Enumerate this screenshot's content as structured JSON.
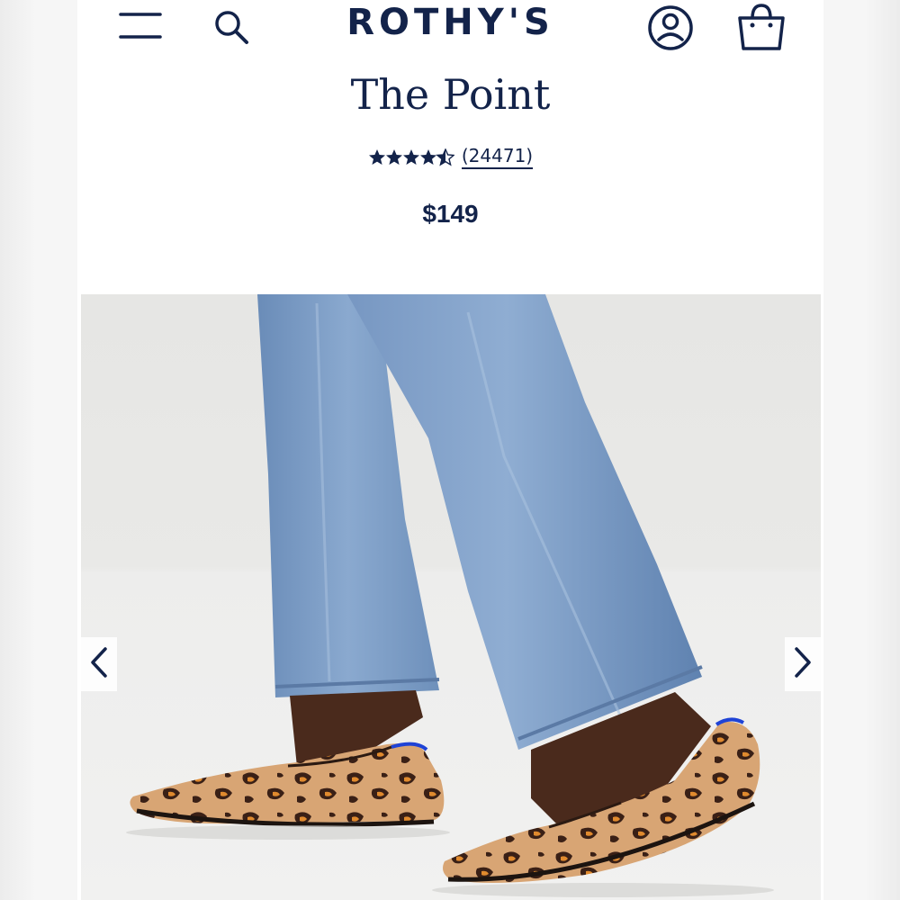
{
  "header": {
    "brand": "ROTHY'S",
    "icons": [
      "menu-icon",
      "search-icon",
      "account-icon",
      "shopping-bag-icon"
    ]
  },
  "product": {
    "title": "The Point",
    "rating": 4.5,
    "review_count": "(24471)",
    "price": "$149"
  },
  "gallery": {
    "image_alt": "Leopard print knit pointed flats worn with light wash straight-leg jeans",
    "prev_icon": "chevron-left-icon",
    "next_icon": "chevron-right-icon"
  },
  "colors": {
    "brand_navy": "#13234a",
    "background": "#ffffff",
    "photo_backdrop": "#e8e8e6",
    "denim": "#7a9bc4",
    "leopard_base": "#d8a574",
    "leopard_spot": "#3a2016",
    "collar_blue": "#1f43d6"
  }
}
